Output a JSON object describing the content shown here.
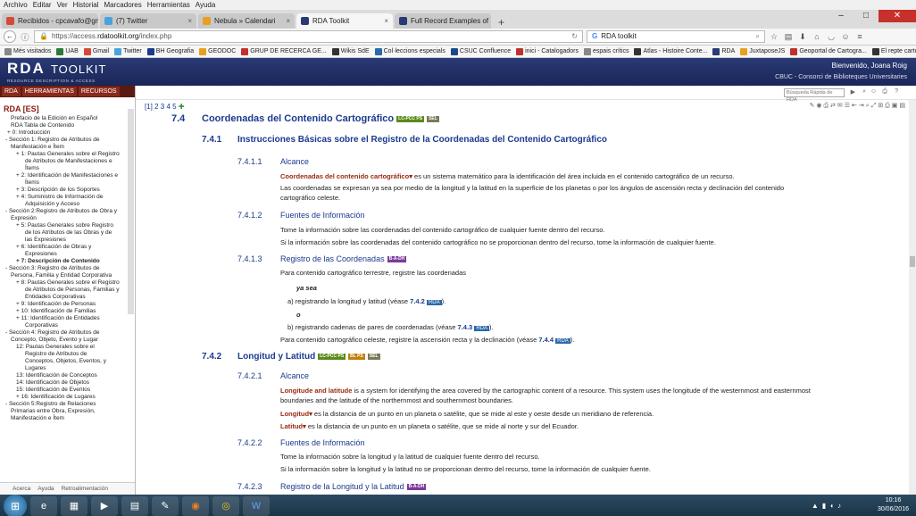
{
  "menubar": [
    "Archivo",
    "Editar",
    "Ver",
    "Historial",
    "Marcadores",
    "Herramientas",
    "Ayuda"
  ],
  "tabs": [
    {
      "label": "Recibidos - cpcavafo@gm...",
      "color": "#d44a3a"
    },
    {
      "label": "(7) Twitter",
      "color": "#4aa3df"
    },
    {
      "label": "Nebula » Calendari",
      "color": "#e8a020"
    },
    {
      "label": "RDA Toolkit",
      "color": "#2a3a75"
    },
    {
      "label": "Full Record Examples of RD...",
      "color": "#2a3a75"
    }
  ],
  "url": {
    "prefix": "https://access.",
    "domain": "rdatoolkit.org",
    "path": "/index.php"
  },
  "search": {
    "value": "RDA toolkit"
  },
  "bookmarks": [
    {
      "label": "Més visitados",
      "color": "#888"
    },
    {
      "label": "UAB",
      "color": "#2a7a3a"
    },
    {
      "label": "Gmail",
      "color": "#d44a3a"
    },
    {
      "label": "Twitter",
      "color": "#4aa3df"
    },
    {
      "label": "BH Geografia",
      "color": "#1c3a8e"
    },
    {
      "label": "GEODOC",
      "color": "#e8a020"
    },
    {
      "label": "GRUP DE RECERCA GE...",
      "color": "#c03030"
    },
    {
      "label": "Wikis SdE",
      "color": "#333"
    },
    {
      "label": "Col·leccions especials",
      "color": "#2a6aaa"
    },
    {
      "label": "CSUC Confluence",
      "color": "#1a4a8a"
    },
    {
      "label": "inici - Catalogadors",
      "color": "#c03030"
    },
    {
      "label": "espais crítics",
      "color": "#888"
    },
    {
      "label": "Atlas - Histoire Conte...",
      "color": "#333"
    },
    {
      "label": "RDA",
      "color": "#2a3a75"
    },
    {
      "label": "JuxtaposeJS",
      "color": "#e8a020"
    },
    {
      "label": "Geoportal de Cartogra...",
      "color": "#c03030"
    },
    {
      "label": "El repte cartogràfic del...",
      "color": "#333"
    }
  ],
  "header": {
    "logo": "RDA",
    "logo_tk": "TOOLKIT",
    "logo_sub": "RESOURCE DESCRIPTION & ACCESS",
    "welcome": "Bienvenido, Joana Roig",
    "org": "CBUC - Consorci de Biblioteques Universitaries"
  },
  "sidebar": {
    "tabs": [
      "RDA",
      "HERRAMIENTAS",
      "RECURSOS"
    ],
    "title": "RDA [ES]",
    "items": [
      {
        "t": "Prefacio de la Edición en Español",
        "i": 12
      },
      {
        "t": "RDA Tabla de Contenido",
        "i": 12
      },
      {
        "t": "+ 0: Introducción",
        "i": 8
      },
      {
        "t": "- Sección 1: Registro de Atributos de",
        "i": 6
      },
      {
        "t": "Manifestación e Ítem",
        "i": 12
      },
      {
        "t": "+ 1: Pautas Generales sobre el Registro",
        "i": 18
      },
      {
        "t": "de Atributos de Manifestaciones e",
        "i": 28
      },
      {
        "t": "Ítems",
        "i": 28
      },
      {
        "t": "+ 2: Identificación de Manifestaciones e",
        "i": 18
      },
      {
        "t": "Ítems",
        "i": 28
      },
      {
        "t": "+ 3: Descripción de los Soportes",
        "i": 18
      },
      {
        "t": "+ 4: Suministro de Información de",
        "i": 18
      },
      {
        "t": "Adquisición y Acceso",
        "i": 28
      },
      {
        "t": "- Sección 2:Registro de Atributos de Obra y",
        "i": 6
      },
      {
        "t": "Expresión",
        "i": 12
      },
      {
        "t": "+ 5: Pautas Generales sobre Registro",
        "i": 18
      },
      {
        "t": "de los Atributos de las Obras y de",
        "i": 28
      },
      {
        "t": "las Expresiones",
        "i": 28
      },
      {
        "t": "+ 6: Identificación de Obras y",
        "i": 18
      },
      {
        "t": "Expresiones",
        "i": 28
      },
      {
        "t": "+ 7: Descripción de Contenido",
        "i": 18,
        "b": true
      },
      {
        "t": "- Sección 3: Registro de Atributos de",
        "i": 6
      },
      {
        "t": "Persona, Familia y Entidad Corporativa",
        "i": 12
      },
      {
        "t": "+ 8: Pautas Generales sobre el Registro",
        "i": 18
      },
      {
        "t": "de Atributos de Personas, Familias y",
        "i": 28
      },
      {
        "t": "Entidades Corporativas",
        "i": 28
      },
      {
        "t": "+ 9: Identificación de Personas",
        "i": 18
      },
      {
        "t": "+ 10: Identificación de Familias",
        "i": 18
      },
      {
        "t": "+ 11: Identificación de Entidades",
        "i": 18
      },
      {
        "t": "Corporativas",
        "i": 28
      },
      {
        "t": "- Sección 4: Registro de Atributos de",
        "i": 6
      },
      {
        "t": "Concepto, Objeto, Evento y Lugar",
        "i": 12
      },
      {
        "t": "12: Pautas Generales sobre el",
        "i": 18
      },
      {
        "t": "Registro de Atributos de",
        "i": 28
      },
      {
        "t": "Conceptos, Objetos, Eventos, y",
        "i": 28
      },
      {
        "t": "Lugares",
        "i": 28
      },
      {
        "t": "13: Identificación de Conceptos",
        "i": 18
      },
      {
        "t": "14: Identificación de Objetos",
        "i": 18
      },
      {
        "t": "15: Identificación de Eventos",
        "i": 18
      },
      {
        "t": "+ 16: Identificación de Lugares",
        "i": 18
      },
      {
        "t": "- Sección 5:Registro de Relaciones",
        "i": 6
      },
      {
        "t": "Primarias entre Obra, Expresión,",
        "i": 12
      },
      {
        "t": "Manifestación e Ítem",
        "i": 12
      }
    ],
    "footer": [
      "Acerca",
      "Ayuda",
      "Retroalimentación"
    ]
  },
  "content": {
    "pages": "[1] 2 3 4 5",
    "quick": "Búsqueda Rápida de RDA",
    "s74": {
      "num": "7.4",
      "title": "Coordenadas del Contenido Cartográfico"
    },
    "s741": {
      "num": "7.4.1",
      "title": "Instrucciones Básicas sobre el Registro de la Coordenadas del Contenido Cartográfico"
    },
    "s7411": {
      "num": "7.4.1.1",
      "title": "Alcance"
    },
    "p1a": "Coordenadas del contenido cartográfico▾",
    "p1b": " es un sistema matemático para la identificación del área incluida en el contenido cartográfico de un recurso.",
    "p2": "Las coordenadas se expresan ya sea por medio de la longitud y la latitud en la superficie de los planetas o por los ángulos de ascensión recta y declinación del contenido",
    "p2b": "cartográfico celeste.",
    "s7412": {
      "num": "7.4.1.2",
      "title": "Fuentes de Información"
    },
    "p3": "Tome la información sobre las coordenadas del contenido cartográfico de cualquier fuente dentro del recurso.",
    "p4": "Si la información sobre las coordenadas del contenido cartográfico no se proporcionan dentro del recurso, tome la información de cualquier fuente.",
    "s7413": {
      "num": "7.4.1.3",
      "title": "Registro de las Coordenadas"
    },
    "p5": "Para contenido cartográfico terrestre, registre las coordenadas",
    "p6": "ya sea",
    "p7a": "a)   registrando la longitud y latitud (véase ",
    "p7l": "7.4.2",
    "p7e": ").",
    "p8": "o",
    "p9a": "b)   registrando cadenas de pares de coordenadas (véase ",
    "p9l": "7.4.3",
    "p9e": ").",
    "p10a": "Para contenido cartográfico celeste, registre la ascensión recta y la declinación (véase ",
    "p10l": "7.4.4",
    "p10e": ").",
    "s742": {
      "num": "7.4.2",
      "title": "Longitud y Latitud"
    },
    "s7421": {
      "num": "7.4.2.1",
      "title": "Alcance"
    },
    "p11a": "Longitude and latitude",
    "p11b": " is a system for identifying the area covered by the cartographic content of a resource. This system uses the longitude of the westernmost and easternmost",
    "p11c": "boundaries and the latitude of the northernmost and southernmost boundaries.",
    "p12a": "Longitud▾",
    "p12b": " es la distancia de un punto en un planeta o satélite, que se mide al este y oeste desde un meridiano de referencia.",
    "p13a": "Latitud▾",
    "p13b": " es la distancia de un punto en un planeta o satélite, que se mide al norte y sur del Ecuador.",
    "s7422": {
      "num": "7.4.2.2",
      "title": "Fuentes de Información"
    },
    "p14": "Tome la información sobre la longitud y la latitud de cualquier fuente dentro del recurso.",
    "p15": "Si la información sobre la longitud y la latitud no se proporcionan dentro del recurso, tome la información de cualquier fuente.",
    "s7423": {
      "num": "7.4.2.3",
      "title": "Registro de la Longitud y la Latitud"
    },
    "rda": "RDA",
    "badges": {
      "lcpcc": "LC-PCC PS",
      "sel": "SEL",
      "bl": "BL PS",
      "sxh": "B-A-DH"
    }
  },
  "taskbar": {
    "time": "10:16",
    "date": "30/06/2016"
  },
  "colors": {
    "lcpcc": "#5a8a1a",
    "sel": "#7a7a5a",
    "bl": "#c08010",
    "sxh": "#7a3a9a"
  }
}
